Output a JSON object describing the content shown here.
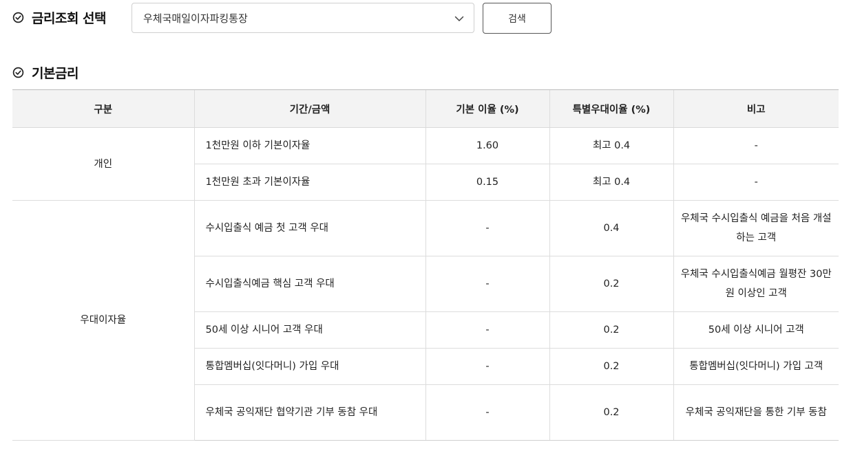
{
  "rate_select": {
    "title": "금리조회 선택",
    "selected_product": "우체국매일이자파킹통장",
    "search_label": "검색"
  },
  "basic_rate": {
    "title": "기본금리",
    "headers": [
      "구분",
      "기간/금액",
      "기본 이율 (%)",
      "특별우대이율 (%)",
      "비고"
    ],
    "groups": [
      {
        "category": "개인",
        "rows": [
          {
            "period": "1천만원 이하 기본이자율",
            "base": "1.60",
            "special": "최고 0.4",
            "note": "-"
          },
          {
            "period": "1천만원 초과 기본이자율",
            "base": "0.15",
            "special": "최고 0.4",
            "note": "-"
          }
        ]
      },
      {
        "category": "우대이자율",
        "rows": [
          {
            "period": "수시입출식 예금 첫 고객 우대",
            "base": "-",
            "special": "0.4",
            "note": "우체국 수시입출식 예금을 처음 개설하는 고객"
          },
          {
            "period": "수시입출식예금 핵심 고객 우대",
            "base": "-",
            "special": "0.2",
            "note": "우체국 수시입출식예금 월평잔 30만원 이상인 고객"
          },
          {
            "period": "50세 이상 시니어 고객 우대",
            "base": "-",
            "special": "0.2",
            "note": "50세 이상 시니어 고객"
          },
          {
            "period": "통합멤버십(잇다머니) 가입 우대",
            "base": "-",
            "special": "0.2",
            "note": "통합멤버십(잇다머니) 가입 고객"
          },
          {
            "period": "우체국 공익재단 협약기관 기부 동참 우대",
            "base": "-",
            "special": "0.2",
            "note": "우체국 공익재단을 통한 기부 동참"
          }
        ]
      }
    ]
  }
}
